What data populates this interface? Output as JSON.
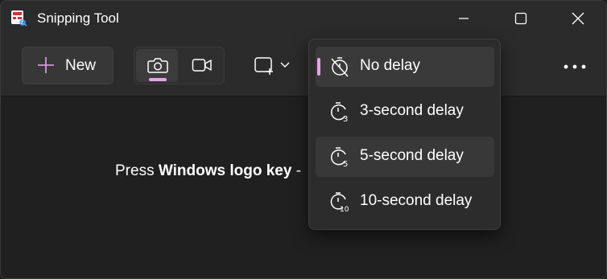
{
  "window": {
    "title": "Snipping Tool"
  },
  "toolbar": {
    "new_label": "New",
    "modes": [
      "snip-mode-photo",
      "snip-mode-video"
    ],
    "accent_color": "#e7a1ec"
  },
  "hint": {
    "prefix": "Press ",
    "key": "Windows logo key",
    "suffix": " -"
  },
  "delay_menu": {
    "items": [
      {
        "label": "No delay",
        "icon": "timer-off-icon",
        "selected": true
      },
      {
        "label": "3-second delay",
        "icon": "timer-3-icon",
        "selected": false
      },
      {
        "label": "5-second delay",
        "icon": "timer-5-icon",
        "selected": false
      },
      {
        "label": "10-second delay",
        "icon": "timer-10-icon",
        "selected": false
      }
    ]
  }
}
